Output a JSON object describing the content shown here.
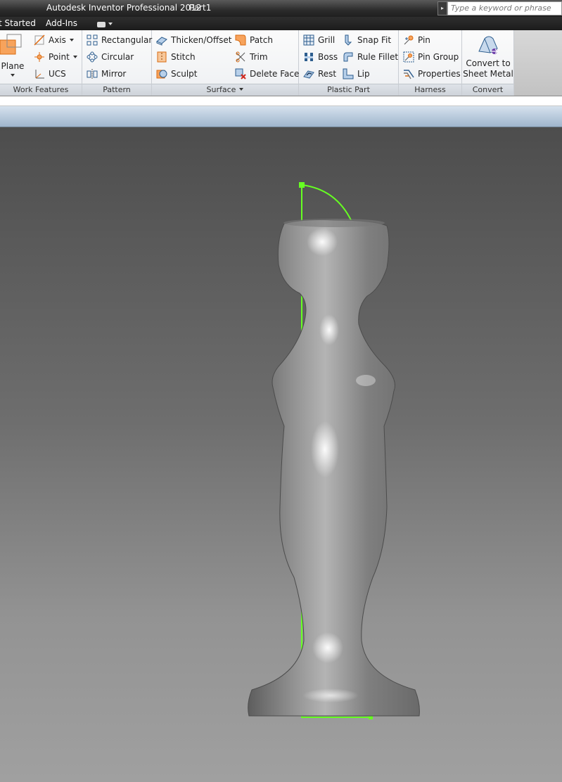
{
  "window": {
    "app_title": "Autodesk Inventor Professional 2012",
    "document_name": "Part1",
    "search_placeholder": "Type a keyword or phrase"
  },
  "tabs": [
    {
      "label": "t Started"
    },
    {
      "label": "Add-Ins"
    }
  ],
  "ribbon": {
    "work_features": {
      "title": "Work Features",
      "plane_label": "Plane",
      "axis_label": "Axis",
      "point_label": "Point",
      "ucs_label": "UCS"
    },
    "pattern": {
      "title": "Pattern",
      "rectangular_label": "Rectangular",
      "circular_label": "Circular",
      "mirror_label": "Mirror"
    },
    "surface": {
      "title": "Surface",
      "thicken_label": "Thicken/Offset",
      "stitch_label": "Stitch",
      "sculpt_label": "Sculpt",
      "patch_label": "Patch",
      "trim_label": "Trim",
      "delete_face_label": "Delete Face"
    },
    "plastic_part": {
      "title": "Plastic Part",
      "grill_label": "Grill",
      "boss_label": "Boss",
      "rest_label": "Rest",
      "snap_fit_label": "Snap Fit",
      "rule_fillet_label": "Rule Fillet",
      "lip_label": "Lip"
    },
    "harness": {
      "title": "Harness",
      "pin_label": "Pin",
      "pin_group_label": "Pin Group",
      "properties_label": "Properties"
    },
    "convert": {
      "title": "Convert",
      "line1": "Convert to",
      "line2": "Sheet Metal"
    }
  },
  "colors": {
    "sketch_highlight": "#66ff22",
    "model_shading": "#8c8c8c",
    "viewport_top": "#4d4d4d",
    "viewport_bottom": "#a0a0a0"
  }
}
